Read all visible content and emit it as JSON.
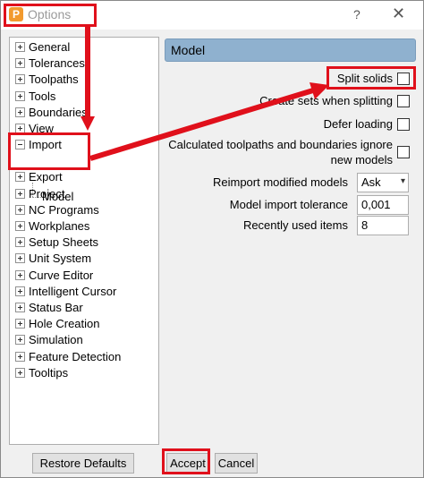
{
  "window": {
    "title": "Options",
    "app_icon_letter": "P",
    "help_label": "?",
    "close_label": "✕"
  },
  "tree": {
    "items": [
      {
        "label": "General",
        "expander": "plus"
      },
      {
        "label": "Tolerances",
        "expander": "plus"
      },
      {
        "label": "Toolpaths",
        "expander": "plus"
      },
      {
        "label": "Tools",
        "expander": "plus"
      },
      {
        "label": "Boundaries",
        "expander": "plus"
      },
      {
        "label": "View",
        "expander": "plus"
      },
      {
        "label": "Import",
        "expander": "minus"
      },
      {
        "label": "Export",
        "expander": "plus"
      },
      {
        "label": "Project",
        "expander": "plus"
      },
      {
        "label": "NC Programs",
        "expander": "plus"
      },
      {
        "label": "Workplanes",
        "expander": "plus"
      },
      {
        "label": "Setup Sheets",
        "expander": "plus"
      },
      {
        "label": "Unit System",
        "expander": "plus"
      },
      {
        "label": "Curve Editor",
        "expander": "plus"
      },
      {
        "label": "Intelligent Cursor",
        "expander": "plus"
      },
      {
        "label": "Status Bar",
        "expander": "plus"
      },
      {
        "label": "Hole Creation",
        "expander": "plus"
      },
      {
        "label": "Simulation",
        "expander": "plus"
      },
      {
        "label": "Feature Detection",
        "expander": "plus"
      },
      {
        "label": "Tooltips",
        "expander": "plus"
      }
    ],
    "import_child": "Model"
  },
  "panel": {
    "title": "Model",
    "split_solids": "Split solids",
    "create_sets": "Create sets when splitting",
    "defer_loading": "Defer loading",
    "calc_line1": "Calculated toolpaths and boundaries ignore",
    "calc_line2": "new models",
    "reimport_label": "Reimport modified models",
    "reimport_value": "Ask",
    "tolerance_label": "Model import tolerance",
    "tolerance_value": "0,001",
    "recent_label": "Recently used items",
    "recent_value": "8"
  },
  "buttons": {
    "restore": "Restore Defaults",
    "accept": "Accept",
    "cancel": "Cancel"
  },
  "colors": {
    "highlight": "#e0101b",
    "panel_header": "#8fb1cf",
    "app_icon": "#f29a2e"
  }
}
